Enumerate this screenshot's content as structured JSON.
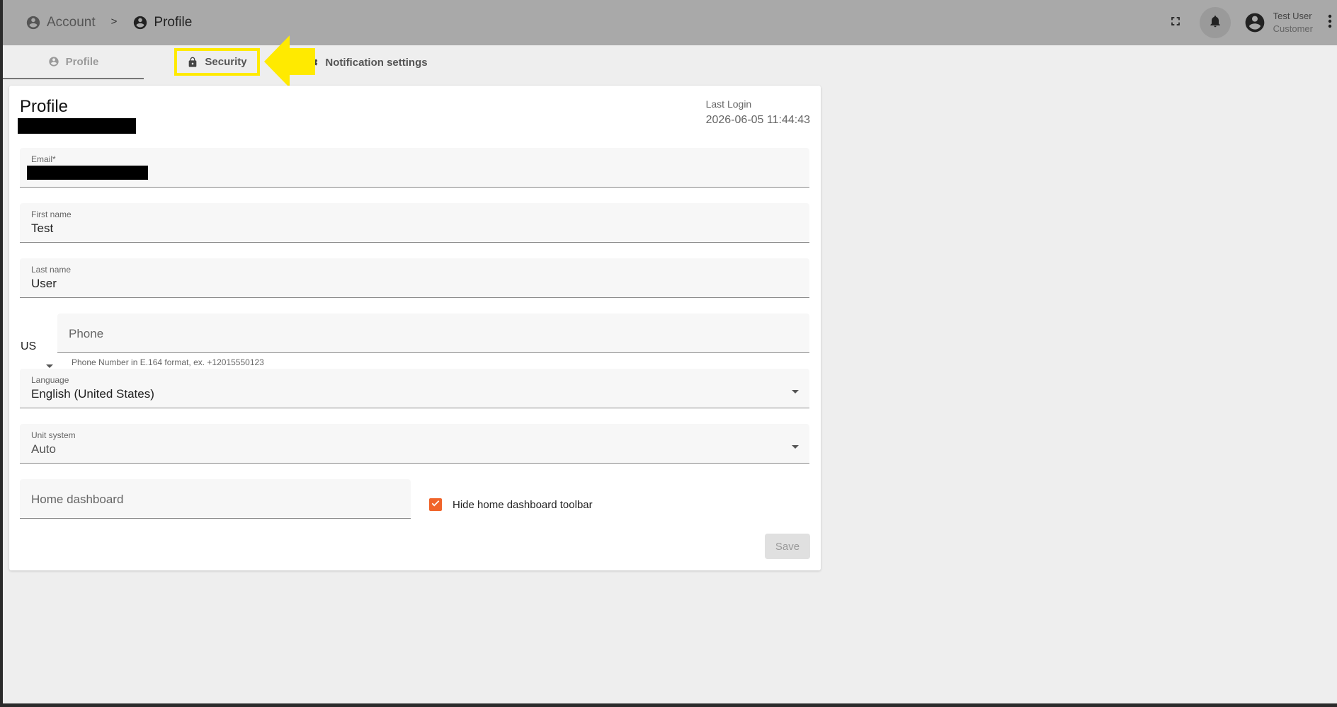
{
  "breadcrumb": {
    "items": [
      {
        "label": "Account",
        "icon": "account-circle-icon"
      },
      {
        "label": "Profile",
        "icon": "account-circle-icon"
      }
    ],
    "separator": ">"
  },
  "header": {
    "user_name": "Test User",
    "user_role": "Customer",
    "icons": [
      "fullscreen-icon",
      "bell-icon",
      "account-circle-icon",
      "more-vert-icon"
    ]
  },
  "tabs": [
    {
      "label": "Profile",
      "icon": "account-circle-icon",
      "active": true
    },
    {
      "label": "Security",
      "icon": "lock-icon",
      "highlighted": true
    },
    {
      "label": "Notification settings",
      "icon": "settings-icon"
    }
  ],
  "annotation": {
    "arrow_color": "#ffea00",
    "highlight_color": "#ffea00"
  },
  "profile": {
    "title": "Profile",
    "last_login_label": "Last Login",
    "last_login_value": "2026-06-05 11:44:43"
  },
  "form": {
    "email_label": "Email*",
    "first_name_label": "First name",
    "first_name_value": "Test",
    "last_name_label": "Last name",
    "last_name_value": "User",
    "country_code": "US",
    "phone_placeholder": "Phone",
    "phone_hint": "Phone Number in E.164 format, ex. +12015550123",
    "language_label": "Language",
    "language_value": "English (United States)",
    "unit_label": "Unit system",
    "unit_value": "Auto",
    "home_dashboard_placeholder": "Home dashboard",
    "hide_toolbar_label": "Hide home dashboard toolbar",
    "hide_toolbar_checked": true,
    "save_label": "Save"
  },
  "colors": {
    "topbar": "#a9a9a9",
    "accent_checkbox": "#f0642a",
    "page_background": "#eeeeee"
  }
}
